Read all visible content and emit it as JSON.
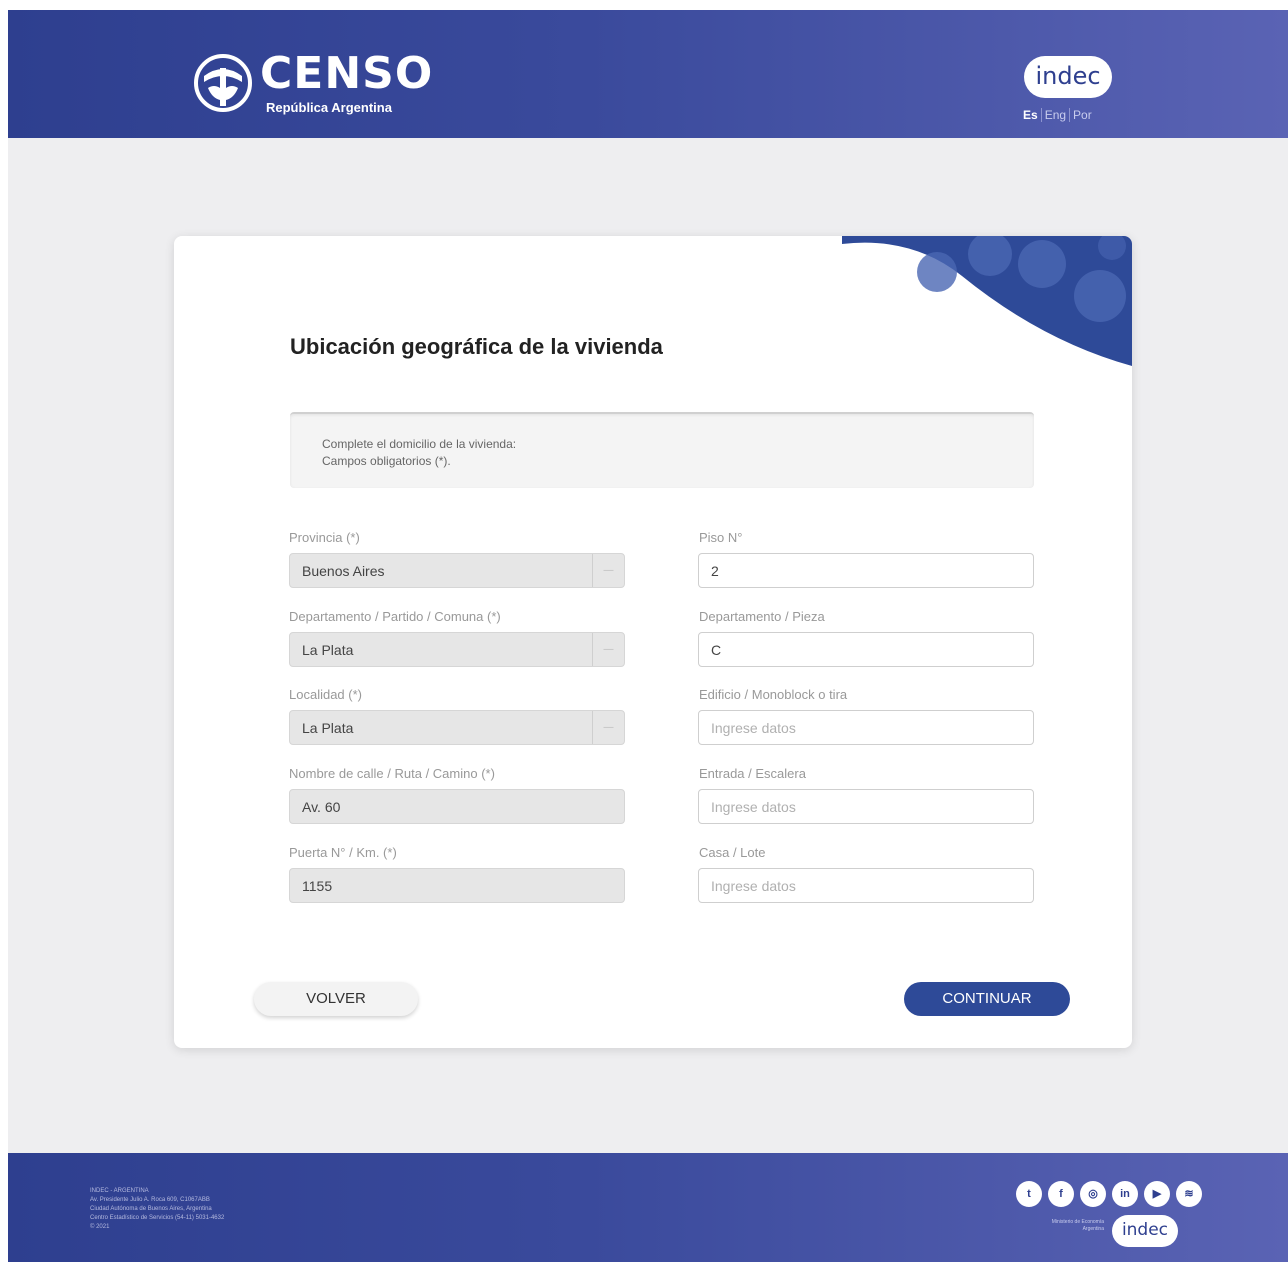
{
  "header": {
    "logo_title": "CENSO",
    "logo_subtitle": "República Argentina",
    "indec_label": "indec",
    "languages": [
      "Es",
      "Eng",
      "Por"
    ]
  },
  "form": {
    "title": "Ubicación geográfica de la vivienda",
    "info_line1": "Complete el domicilio de la vivienda:",
    "info_line2": "Campos obligatorios (*).",
    "left_fields": [
      {
        "label": "Provincia (*)",
        "value": "Buenos Aires",
        "type": "select"
      },
      {
        "label": "Departamento / Partido / Comuna (*)",
        "value": "La Plata",
        "type": "select"
      },
      {
        "label": "Localidad (*)",
        "value": "La Plata",
        "type": "select"
      },
      {
        "label": "Nombre de calle / Ruta / Camino (*)",
        "value": "Av. 60",
        "type": "text"
      },
      {
        "label": "Puerta N° / Km. (*)",
        "value": "1155",
        "type": "text"
      }
    ],
    "right_fields": [
      {
        "label": "Piso N°",
        "value": "2",
        "placeholder": ""
      },
      {
        "label": "Departamento / Pieza",
        "value": "C",
        "placeholder": ""
      },
      {
        "label": "Edificio / Monoblock o tira",
        "value": "",
        "placeholder": "Ingrese datos"
      },
      {
        "label": "Entrada / Escalera",
        "value": "",
        "placeholder": "Ingrese datos"
      },
      {
        "label": "Casa / Lote",
        "value": "",
        "placeholder": "Ingrese datos"
      }
    ],
    "back_label": "VOLVER",
    "next_label": "CONTINUAR"
  },
  "footer": {
    "address_lines": [
      "INDEC - ARGENTINA",
      "Av. Presidente Julio A. Roca 609, C1067ABB",
      "Ciudad Autónoma de Buenos Aires, Argentina",
      "Centro Estadístico de Servicios (54-11) 5031-4632",
      "© 2021"
    ],
    "ministry_lines": [
      "Ministerio de Economía",
      "Argentina"
    ],
    "indec_label": "indec",
    "social_icons": [
      "twitter-icon",
      "facebook-icon",
      "instagram-icon",
      "linkedin-icon",
      "youtube-icon",
      "spotify-icon"
    ]
  },
  "colors": {
    "brand_blue": "#2e3f8f",
    "button_blue": "#2e4a98"
  }
}
